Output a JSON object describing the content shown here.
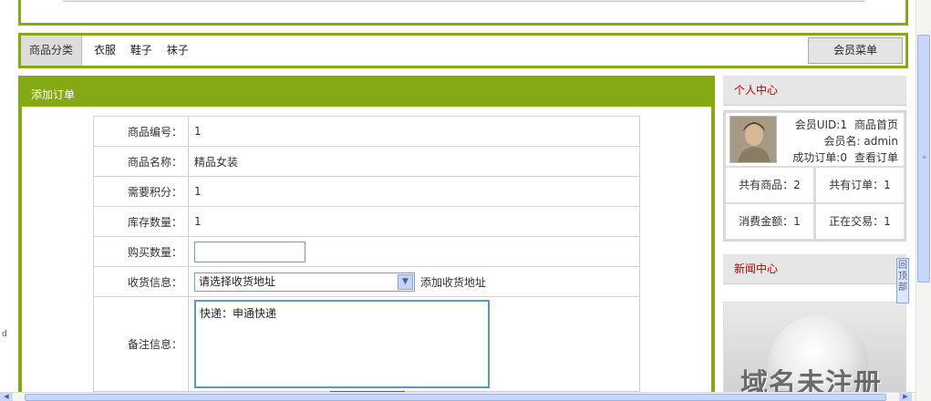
{
  "nav": {
    "category_label": "商品分类",
    "categories": [
      "衣服",
      "鞋子",
      "袜子"
    ],
    "member_menu": "会员菜单"
  },
  "order": {
    "title": "添加订单",
    "fields": {
      "product_id_label": "商品编号：",
      "product_id": "1",
      "product_name_label": "商品名称：",
      "product_name": "精品女装",
      "points_label": "需要积分：",
      "points": "1",
      "stock_label": "库存数量：",
      "stock": "1",
      "quantity_label": "购买数量：",
      "quantity_value": "",
      "shipping_label": "收货信息：",
      "shipping_select": "请选择收货地址",
      "add_address": "添加收货地址",
      "remark_label": "备注信息：",
      "remark_value": "快递：申通快递"
    }
  },
  "sidebar": {
    "personal_title": "个人中心",
    "uid_text": "会员UID:1",
    "home_link": "商品首页",
    "name_text": "会员名: admin",
    "success_orders": "成功订单:0",
    "view_orders": "查看订单",
    "stats": {
      "total_products": "共有商品：2",
      "total_orders": "共有订单：1",
      "spent": "消费金额：1",
      "trading": "正在交易：1"
    },
    "news_title": "新闻中心",
    "watermark": "域名未注册"
  },
  "scroll": {
    "back_top": "回顶部"
  },
  "misc": {
    "left_mark": "d"
  },
  "colors": {
    "accent": "#84a914",
    "side_title": "#c00000"
  }
}
